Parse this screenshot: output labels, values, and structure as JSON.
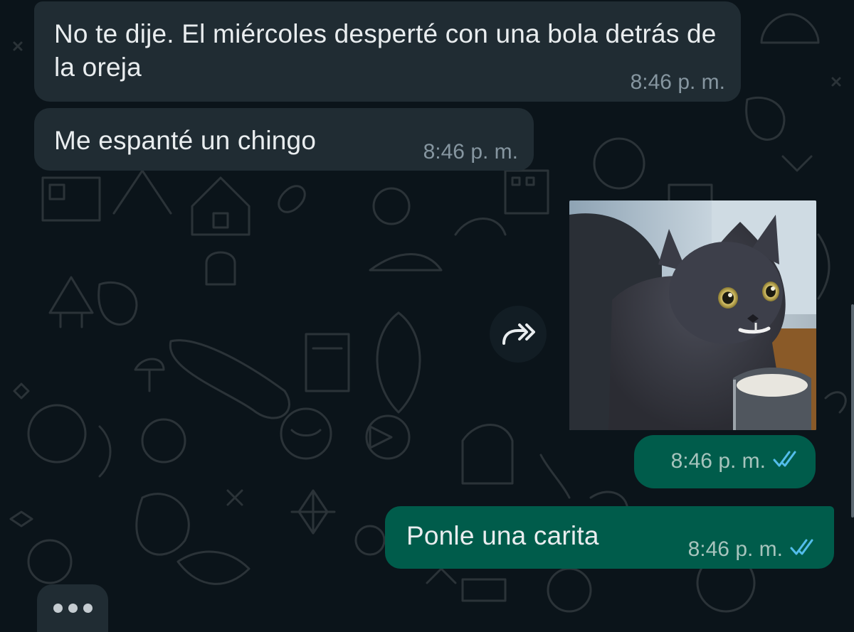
{
  "messages": [
    {
      "direction": "in",
      "text": "No te dije. El miércoles desperté con una bola detrás de la oreja",
      "time": "8:46 p. m."
    },
    {
      "direction": "in",
      "text": "Me espanté un chingo",
      "time": "8:46 p. m."
    },
    {
      "direction": "out",
      "type": "image",
      "image_description": "gray cat with milk on its whiskers next to a glass of milk",
      "time": "8:46 p. m.",
      "status": "read"
    },
    {
      "direction": "out",
      "text": "Ponle una carita",
      "time": "8:46 p. m.",
      "status": "read"
    }
  ],
  "icons": {
    "forward": "forward-icon",
    "read_receipt": "double-check-icon",
    "typing": "typing-indicator"
  },
  "colors": {
    "background": "#0b141a",
    "incoming_bubble": "#202c33",
    "outgoing_bubble": "#005c4b",
    "read_ticks": "#53bdeb",
    "timestamp_in": "#8696a0"
  }
}
